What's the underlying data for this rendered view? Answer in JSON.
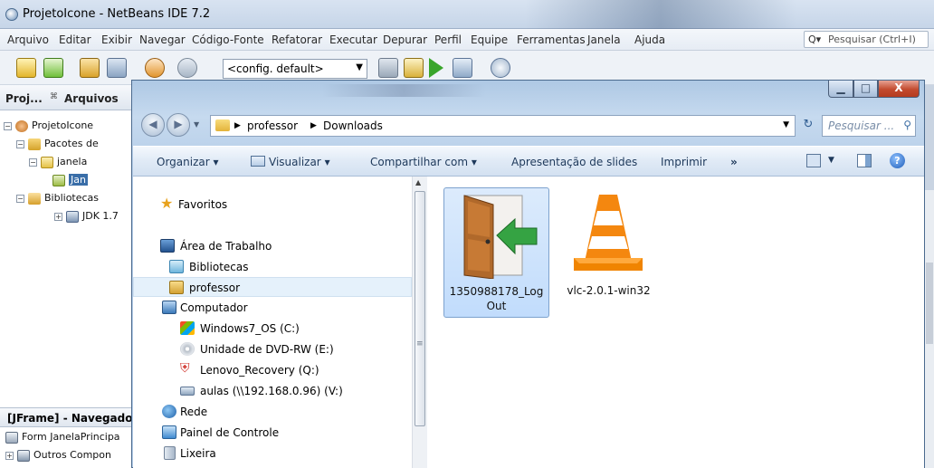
{
  "netbeans": {
    "title": "ProjetoIcone - NetBeans IDE 7.2",
    "menu": [
      "Arquivo",
      "Editar",
      "Exibir",
      "Navegar",
      "Código-Fonte",
      "Refatorar",
      "Executar",
      "Depurar",
      "Perfil",
      "Equipe",
      "Ferramentas",
      "Janela",
      "Ajuda"
    ],
    "search_placeholder": "Pesquisar (Ctrl+I)",
    "config_value": "<config. default>",
    "project_tab": "Proj...",
    "files_tab": "Arquivos",
    "tree": {
      "project": "ProjetoIcone",
      "packages": "Pacotes de",
      "janela": "janela",
      "jan": "Jan",
      "libraries": "Bibliotecas",
      "jdk": "JDK 1.7"
    },
    "navigator_title": "[JFrame] - Navegador",
    "nav_tree": {
      "form": "Form JanelaPrincipa",
      "others": "Outros Compon"
    }
  },
  "explorer": {
    "breadcrumb": [
      "professor",
      "Downloads"
    ],
    "search_placeholder": "Pesquisar ...",
    "commands": {
      "organize": "Organizar",
      "view": "Visualizar",
      "share": "Compartilhar com",
      "slideshow": "Apresentação de slides",
      "print": "Imprimir",
      "more": "»"
    },
    "nav": {
      "favorites": "Favoritos",
      "desktop": "Área de Trabalho",
      "libraries": "Bibliotecas",
      "professor": "professor",
      "computer": "Computador",
      "windows7": "Windows7_OS (C:)",
      "dvd": "Unidade de DVD-RW (E:)",
      "lenovo": "Lenovo_Recovery (Q:)",
      "aulas": "aulas (\\\\192.168.0.96) (V:)",
      "network": "Rede",
      "control_panel": "Painel de Controle",
      "trash": "Lixeira"
    },
    "files": [
      {
        "name_line1": "1350988178_Log",
        "name_line2": "Out",
        "icon": "logout-door-icon",
        "selected": true
      },
      {
        "name_line1": "vlc-2.0.1-win32",
        "name_line2": "",
        "icon": "vlc-cone-icon",
        "selected": false
      }
    ],
    "colors": {
      "selection": "#c1dcfc",
      "accent": "#1e395b",
      "close": "#c24a2e"
    }
  }
}
